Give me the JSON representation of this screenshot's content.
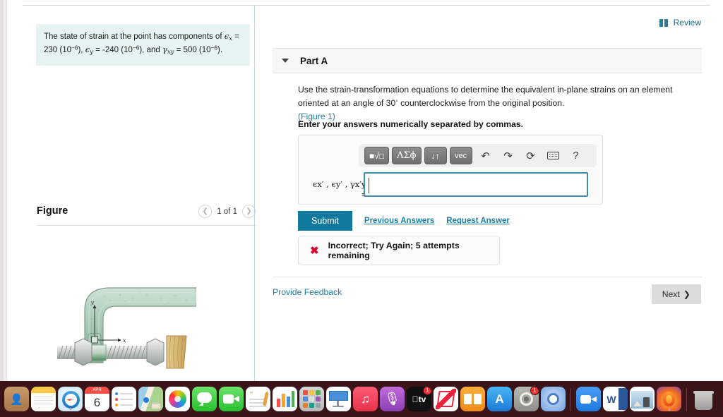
{
  "left_panel": {
    "problem_statement": {
      "line1_pre": "The state of strain at the point has components of ",
      "eps_x_sym": "ϵ",
      "eps_x_sub": "x",
      "eq1": " = 230 (10",
      "exp1": "−6",
      "mid1": "), ",
      "eps_y_sym": "ϵ",
      "eps_y_sub": "y",
      "eq2": " = -240 (10",
      "exp2": "−6",
      "mid2": "), and ",
      "gam_sym": "γ",
      "gam_sub": "xy",
      "eq3": " = 500 (10",
      "exp3": "−6",
      "end": ")."
    },
    "figure_title": "Figure",
    "pager": {
      "prev_icon": "chevron-left-icon",
      "label": "1 of 1",
      "next_icon": "chevron-right-icon"
    },
    "figure_alt": "C-clamp with screw, nuts and wooden block; element with x-y axes marked on the clamp frame",
    "figure_labels": {
      "x_axis": "x",
      "y_axis": "y"
    }
  },
  "right_panel": {
    "review": {
      "icon": "book-icon",
      "label": "Review"
    },
    "part": {
      "caret_icon": "caret-down-icon",
      "title": "Part A"
    },
    "prompt": {
      "text_part1": "Use the strain-transformation equations to determine the equivalent in-plane strains on an element oriented at an angle of 30",
      "degree": "◦",
      "text_part2": " counterclockwise from the original position.",
      "figure_link": "(Figure 1)"
    },
    "instruction": "Enter your answers numerically separated by commas.",
    "answer": {
      "toolbar_buttons": [
        {
          "name": "template-radical-button",
          "label": "■√□"
        },
        {
          "name": "greek-symbols-button",
          "label": "ΛΣϕ"
        },
        {
          "name": "arrows-button",
          "label": "↓↑"
        },
        {
          "name": "vector-button",
          "label": "vec"
        }
      ],
      "toolbar_icons": [
        {
          "name": "undo-icon",
          "glyph": "↶"
        },
        {
          "name": "redo-icon",
          "glyph": "↷"
        },
        {
          "name": "reset-icon",
          "glyph": "⟳"
        },
        {
          "name": "keyboard-icon",
          "glyph": "keyboard"
        },
        {
          "name": "help-icon",
          "glyph": "?"
        }
      ],
      "label": "ϵx′ , ϵy′ , γx′y′ =",
      "value": "",
      "placeholder": ""
    },
    "submit": "Submit",
    "previous_answers": "Previous Answers",
    "request_answer": "Request Answer",
    "feedback_status": {
      "icon": "x-mark-icon",
      "text": "Incorrect; Try Again; 5 attempts remaining"
    },
    "provide_feedback": "Provide Feedback",
    "next": "Next",
    "next_chevron": "❯"
  },
  "colors": {
    "accent_teal": "#0f7a9d",
    "link_blue": "#1a7fa0",
    "error_red": "#d90429",
    "problem_bg": "#e7f3f1",
    "input_border": "#3f8fa8"
  },
  "dock": {
    "apps": [
      {
        "name": "contacts",
        "label": "Contacts"
      },
      {
        "name": "notes",
        "label": "Notes"
      },
      {
        "name": "safari",
        "label": "Safari"
      },
      {
        "name": "calendar",
        "label": "Calendar",
        "month": "APR",
        "day": "6"
      },
      {
        "name": "reminders",
        "label": "Reminders"
      },
      {
        "name": "maps",
        "label": "Maps"
      },
      {
        "name": "photos",
        "label": "Photos"
      },
      {
        "name": "messages",
        "label": "Messages"
      },
      {
        "name": "facetime",
        "label": "FaceTime"
      },
      {
        "name": "pages",
        "label": "Pages"
      },
      {
        "name": "numbers",
        "label": "Numbers"
      },
      {
        "name": "launchpad",
        "label": "Launchpad"
      },
      {
        "name": "keynote",
        "label": "Keynote"
      },
      {
        "name": "music",
        "label": "Music"
      },
      {
        "name": "podcasts",
        "label": "Podcasts"
      },
      {
        "name": "apple-tv",
        "label": "Apple TV",
        "badge": "1"
      },
      {
        "name": "news",
        "label": "News"
      },
      {
        "name": "books",
        "label": "Books"
      },
      {
        "name": "app-store",
        "label": "App Store"
      },
      {
        "name": "system-preferences",
        "label": "System Preferences",
        "badge": "1"
      },
      {
        "name": "chromium",
        "label": "Chromium"
      },
      {
        "name": "zoom",
        "label": "Zoom"
      },
      {
        "name": "word",
        "label": "Microsoft Word",
        "letter": "W"
      },
      {
        "name": "preview",
        "label": "Preview"
      },
      {
        "name": "firefox",
        "label": "Firefox"
      },
      {
        "name": "trash",
        "label": "Trash"
      }
    ]
  }
}
